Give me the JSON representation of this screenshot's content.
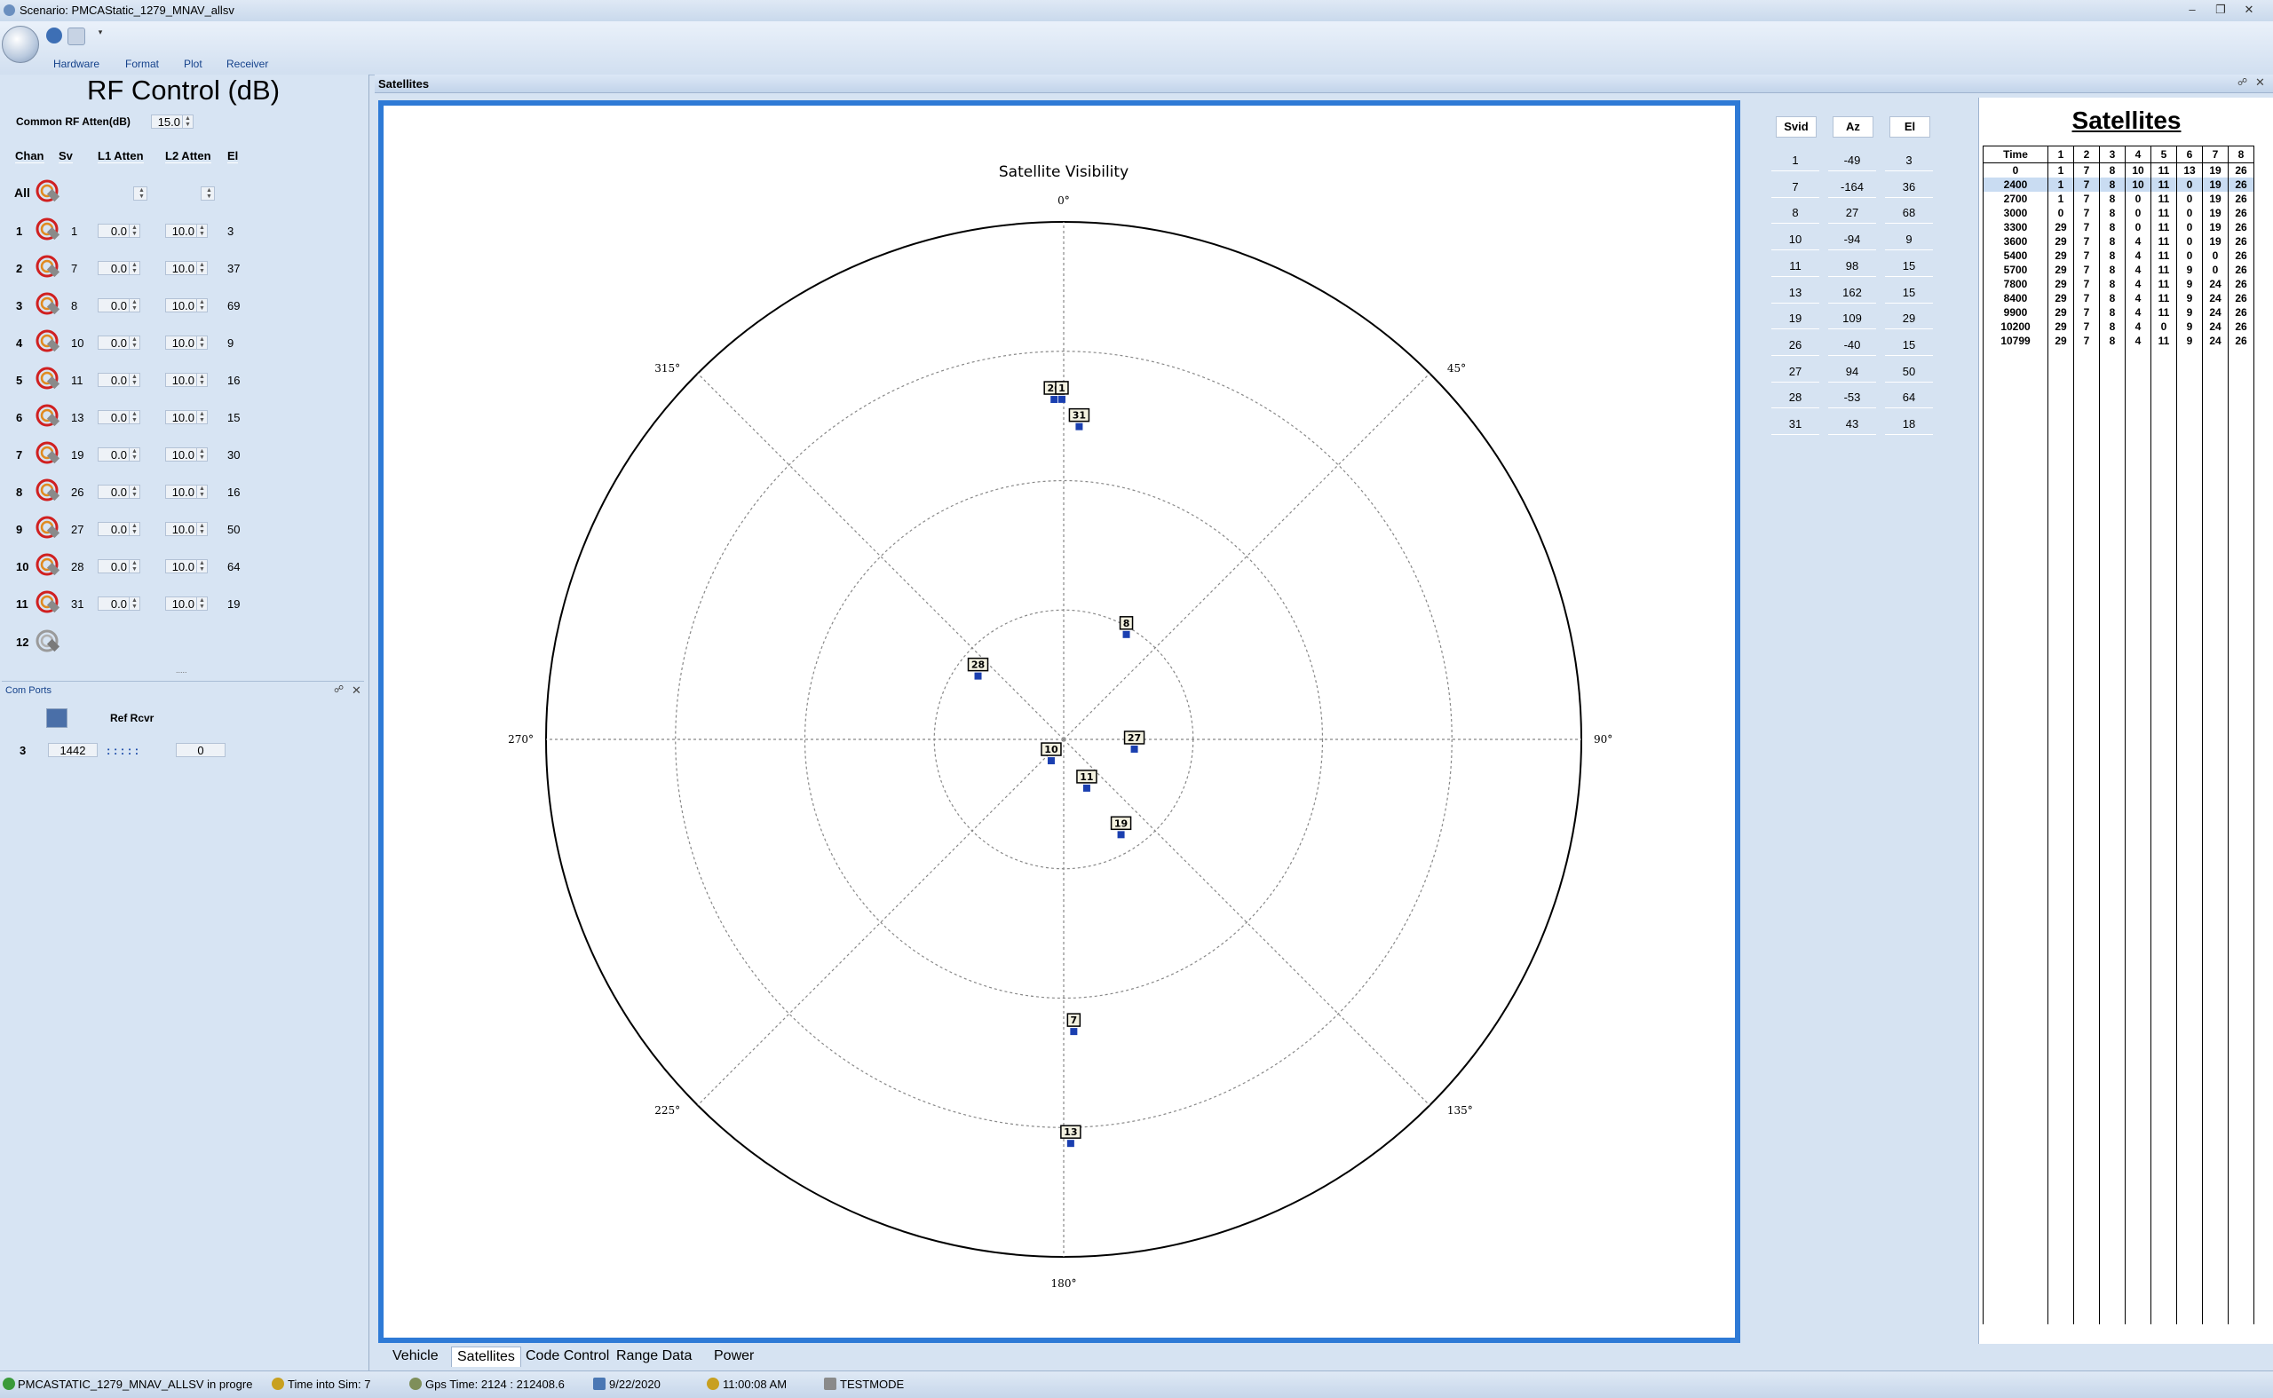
{
  "window": {
    "title": "Scenario: PMCAStatic_1279_MNAV_allsv"
  },
  "menu": [
    "Hardware",
    "Format",
    "Plot",
    "Receiver"
  ],
  "rf_control": {
    "title": "RF Control (dB)",
    "common_label": "Common RF Atten(dB)",
    "common_value": "15.0",
    "headers": {
      "chan": "Chan",
      "sv": "Sv",
      "l1": "L1 Atten",
      "l2": "L2 Atten",
      "el": "El"
    },
    "all_label": "All",
    "rows": [
      {
        "chan": "1",
        "sv": "1",
        "l1": "0.0",
        "l2": "10.0",
        "el": "3"
      },
      {
        "chan": "2",
        "sv": "7",
        "l1": "0.0",
        "l2": "10.0",
        "el": "37"
      },
      {
        "chan": "3",
        "sv": "8",
        "l1": "0.0",
        "l2": "10.0",
        "el": "69"
      },
      {
        "chan": "4",
        "sv": "10",
        "l1": "0.0",
        "l2": "10.0",
        "el": "9"
      },
      {
        "chan": "5",
        "sv": "11",
        "l1": "0.0",
        "l2": "10.0",
        "el": "16"
      },
      {
        "chan": "6",
        "sv": "13",
        "l1": "0.0",
        "l2": "10.0",
        "el": "15"
      },
      {
        "chan": "7",
        "sv": "19",
        "l1": "0.0",
        "l2": "10.0",
        "el": "30"
      },
      {
        "chan": "8",
        "sv": "26",
        "l1": "0.0",
        "l2": "10.0",
        "el": "16"
      },
      {
        "chan": "9",
        "sv": "27",
        "l1": "0.0",
        "l2": "10.0",
        "el": "50"
      },
      {
        "chan": "10",
        "sv": "28",
        "l1": "0.0",
        "l2": "10.0",
        "el": "64"
      },
      {
        "chan": "11",
        "sv": "31",
        "l1": "0.0",
        "l2": "10.0",
        "el": "19"
      }
    ],
    "last_chan": "12"
  },
  "com_ports": {
    "title": "Com Ports",
    "ref_label": "Ref Rcvr",
    "row": {
      "num": "3",
      "port": "1442",
      "dots": ": : : : :",
      "value": "0"
    }
  },
  "center": {
    "header": "Satellites",
    "tabs": [
      "Vehicle",
      "Satellites",
      "Code Control",
      "Range Data",
      "Power"
    ],
    "active_tab": "Satellites"
  },
  "chart_data": {
    "type": "polar-skyplot",
    "title": "Satellite Visibility",
    "angle_labels": [
      "0°",
      "45°",
      "90°",
      "135°",
      "180°",
      "225°",
      "270°",
      "315°"
    ],
    "rings": 4,
    "points": [
      {
        "sv": "1",
        "az": -49,
        "el": 3
      },
      {
        "sv": "7",
        "az": -164,
        "el": 36
      },
      {
        "sv": "8",
        "az": 27,
        "el": 68
      },
      {
        "sv": "10",
        "az": -94,
        "el": 9
      },
      {
        "sv": "11",
        "az": 98,
        "el": 15
      },
      {
        "sv": "13",
        "az": 162,
        "el": 15
      },
      {
        "sv": "19",
        "az": 109,
        "el": 29
      },
      {
        "sv": "26",
        "az": -40,
        "el": 15
      },
      {
        "sv": "27",
        "az": 94,
        "el": 50
      },
      {
        "sv": "28",
        "az": -53,
        "el": 64
      },
      {
        "sv": "31",
        "az": 43,
        "el": 18
      }
    ],
    "marker_labels": [
      {
        "label": "26",
        "r": 0.664,
        "ang": -1.6
      },
      {
        "label": "1",
        "r": 0.664,
        "ang": -0.3
      },
      {
        "label": "31",
        "r": 0.612,
        "ang": 2.8
      },
      {
        "label": "8",
        "r": 0.242,
        "ang": 30.0
      },
      {
        "label": "28",
        "r": 0.21,
        "ang": -52.0
      },
      {
        "label": "27",
        "r": 0.137,
        "ang": 95.0
      },
      {
        "label": "10",
        "r": 0.042,
        "ang": -145.0
      },
      {
        "label": "11",
        "r": 0.098,
        "ang": 153.0
      },
      {
        "label": "19",
        "r": 0.209,
        "ang": 148.0
      },
      {
        "label": "7",
        "r": 0.558,
        "ang": 178.0
      },
      {
        "label": "13",
        "r": 0.774,
        "ang": 179.0
      }
    ]
  },
  "sv_table": {
    "headers": [
      "Svid",
      "Az",
      "El"
    ],
    "rows": [
      [
        "1",
        "-49",
        "3"
      ],
      [
        "7",
        "-164",
        "36"
      ],
      [
        "8",
        "27",
        "68"
      ],
      [
        "10",
        "-94",
        "9"
      ],
      [
        "11",
        "98",
        "15"
      ],
      [
        "13",
        "162",
        "15"
      ],
      [
        "19",
        "109",
        "29"
      ],
      [
        "26",
        "-40",
        "15"
      ],
      [
        "27",
        "94",
        "50"
      ],
      [
        "28",
        "-53",
        "64"
      ],
      [
        "31",
        "43",
        "18"
      ]
    ]
  },
  "sat_schedule": {
    "title": "Satellites",
    "headers": [
      "Time",
      "1",
      "2",
      "3",
      "4",
      "5",
      "6",
      "7",
      "8"
    ],
    "highlight_row": 1,
    "rows": [
      [
        "0",
        "1",
        "7",
        "8",
        "10",
        "11",
        "13",
        "19",
        "26"
      ],
      [
        "2400",
        "1",
        "7",
        "8",
        "10",
        "11",
        "0",
        "19",
        "26"
      ],
      [
        "2700",
        "1",
        "7",
        "8",
        "0",
        "11",
        "0",
        "19",
        "26"
      ],
      [
        "3000",
        "0",
        "7",
        "8",
        "0",
        "11",
        "0",
        "19",
        "26"
      ],
      [
        "3300",
        "29",
        "7",
        "8",
        "0",
        "11",
        "0",
        "19",
        "26"
      ],
      [
        "3600",
        "29",
        "7",
        "8",
        "4",
        "11",
        "0",
        "19",
        "26"
      ],
      [
        "5400",
        "29",
        "7",
        "8",
        "4",
        "11",
        "0",
        "0",
        "26"
      ],
      [
        "5700",
        "29",
        "7",
        "8",
        "4",
        "11",
        "9",
        "0",
        "26"
      ],
      [
        "7800",
        "29",
        "7",
        "8",
        "4",
        "11",
        "9",
        "24",
        "26"
      ],
      [
        "8400",
        "29",
        "7",
        "8",
        "4",
        "11",
        "9",
        "24",
        "26"
      ],
      [
        "9900",
        "29",
        "7",
        "8",
        "4",
        "11",
        "9",
        "24",
        "26"
      ],
      [
        "10200",
        "29",
        "7",
        "8",
        "4",
        "0",
        "9",
        "24",
        "26"
      ],
      [
        "10799",
        "29",
        "7",
        "8",
        "4",
        "11",
        "9",
        "24",
        "26"
      ]
    ]
  },
  "status": {
    "scenario": "PMCASTATIC_1279_MNAV_ALLSV in progre",
    "time_into_sim": "Time into Sim: 7",
    "gps_time": "Gps Time: 2124 : 212408.6",
    "date": "9/22/2020",
    "clock": "11:00:08 AM",
    "mode": "TESTMODE"
  }
}
